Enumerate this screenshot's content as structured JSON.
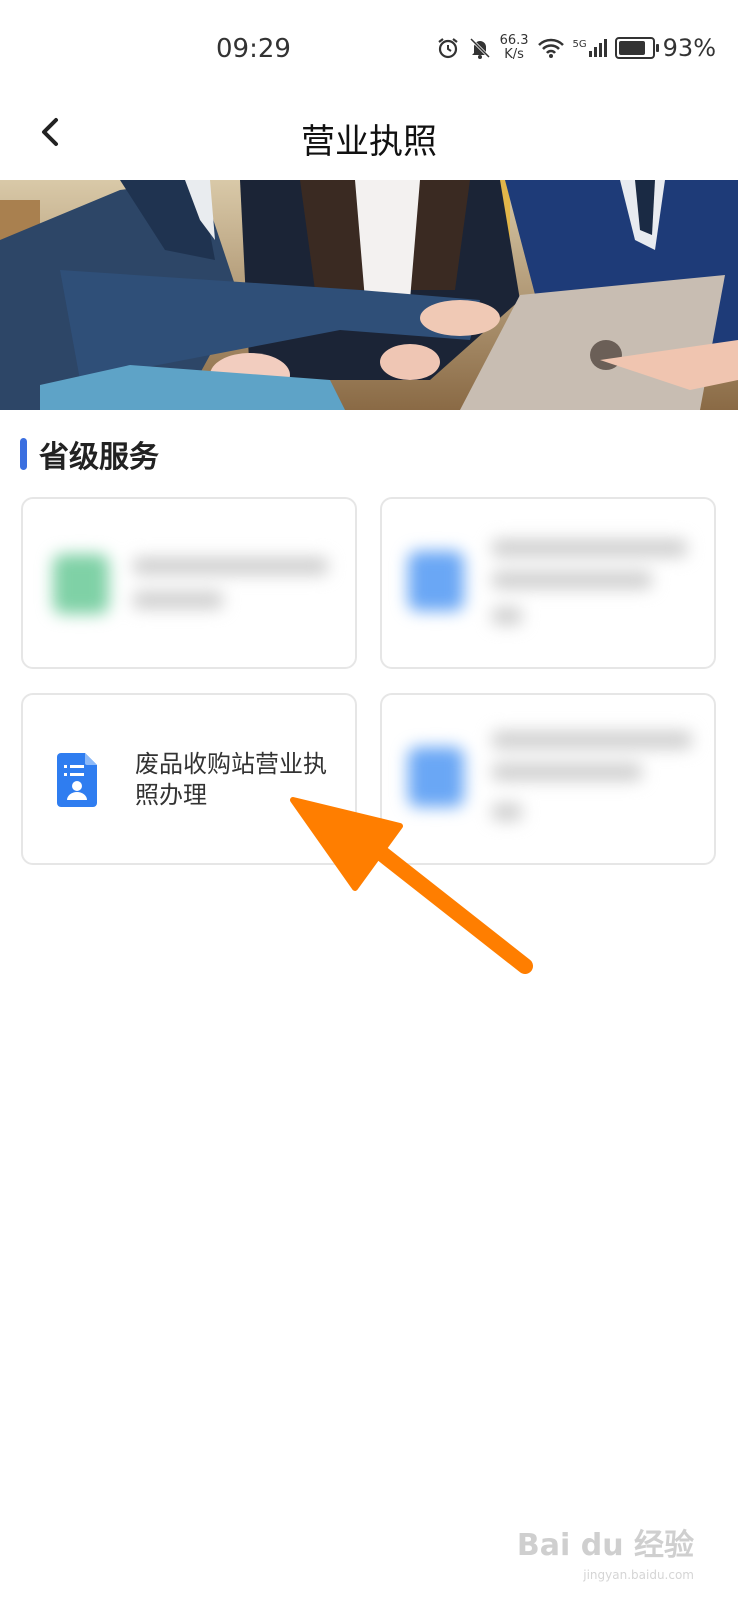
{
  "status_bar": {
    "time": "09:29",
    "speed_value": "66.3",
    "speed_unit": "K/s",
    "network": "5G",
    "battery_percent": "93%",
    "battery_level": 0.93
  },
  "header": {
    "title": "营业执照"
  },
  "section": {
    "title": "省级服务",
    "accent_color": "#3b6fe0"
  },
  "services": [
    {
      "label": "",
      "blurred": true,
      "icon_color": "#4fc38a"
    },
    {
      "label": "",
      "blurred": true,
      "icon_color": "#3a8df5"
    },
    {
      "label": "废品收购站营业执照办理",
      "blurred": false,
      "icon": "document-person-icon",
      "icon_color": "#2f7df0"
    },
    {
      "label": "",
      "blurred": true,
      "icon_color": "#3a8df5"
    }
  ],
  "watermark": {
    "brand": "Bai du 经验",
    "url": "jingyan.baidu.com"
  },
  "annotation_color": "#ff7e00"
}
